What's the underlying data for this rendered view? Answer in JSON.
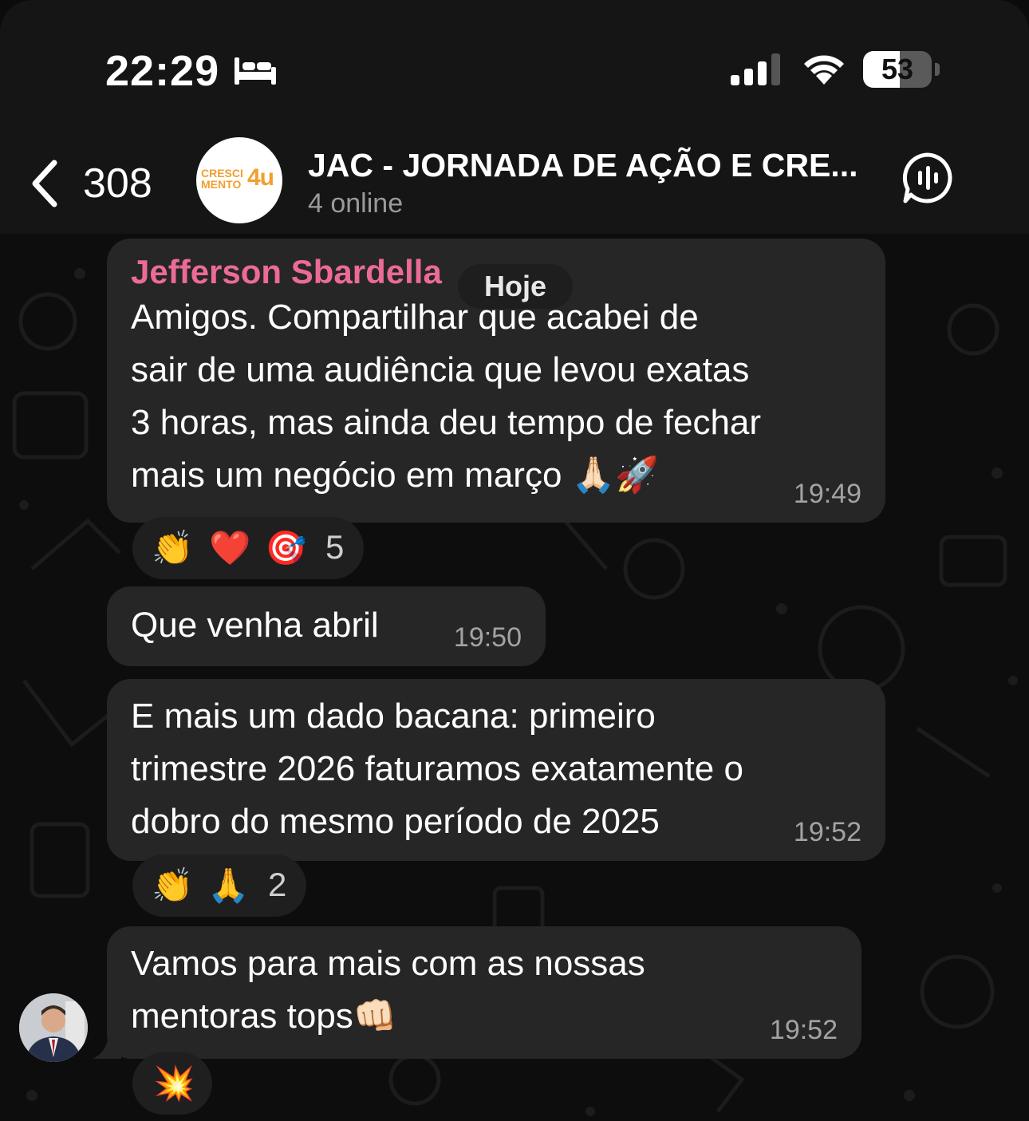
{
  "status_bar": {
    "time": "22:29",
    "battery": "53",
    "battery_level": 0.53,
    "icons": [
      "bed-icon",
      "signal-icon",
      "wifi-icon",
      "battery-icon"
    ]
  },
  "header": {
    "back_count": "308",
    "avatar_logo_left": "CRESCI\nMENTO",
    "avatar_logo_right": "4u",
    "title": "JAC - JORNADA DE AÇÃO E CRE...",
    "subtitle": "4 online"
  },
  "chat": {
    "date_label": "Hoje",
    "messages": [
      {
        "sender": "Jefferson Sbardella",
        "text": "Amigos. Compartilhar que acabei de\nsair de uma audiência que levou exatas\n3 horas, mas ainda deu tempo de fechar\nmais um negócio em março 🙏🏻🚀",
        "time": "19:49",
        "reactions": [
          "👏",
          "❤️",
          "🎯"
        ],
        "reaction_count": "5"
      },
      {
        "text": "Que venha abril",
        "time": "19:50"
      },
      {
        "text": "E mais um dado bacana: primeiro\ntrimestre 2026 faturamos exatamente o\ndobro do mesmo período de 2025",
        "time": "19:52",
        "reactions": [
          "👏",
          "🙏"
        ],
        "reaction_count": "2"
      },
      {
        "text": "Vamos para mais com as nossas\nmentoras tops👊🏻",
        "time": "19:52",
        "reactions": [
          "💥"
        ]
      }
    ]
  },
  "colors": {
    "background": "#0d0d0d",
    "bar": "#151515",
    "bubble": "#262626",
    "sender_name": "#ec6b96",
    "timestamp": "#a3a3a3",
    "logo_orange": "#f0a030"
  }
}
